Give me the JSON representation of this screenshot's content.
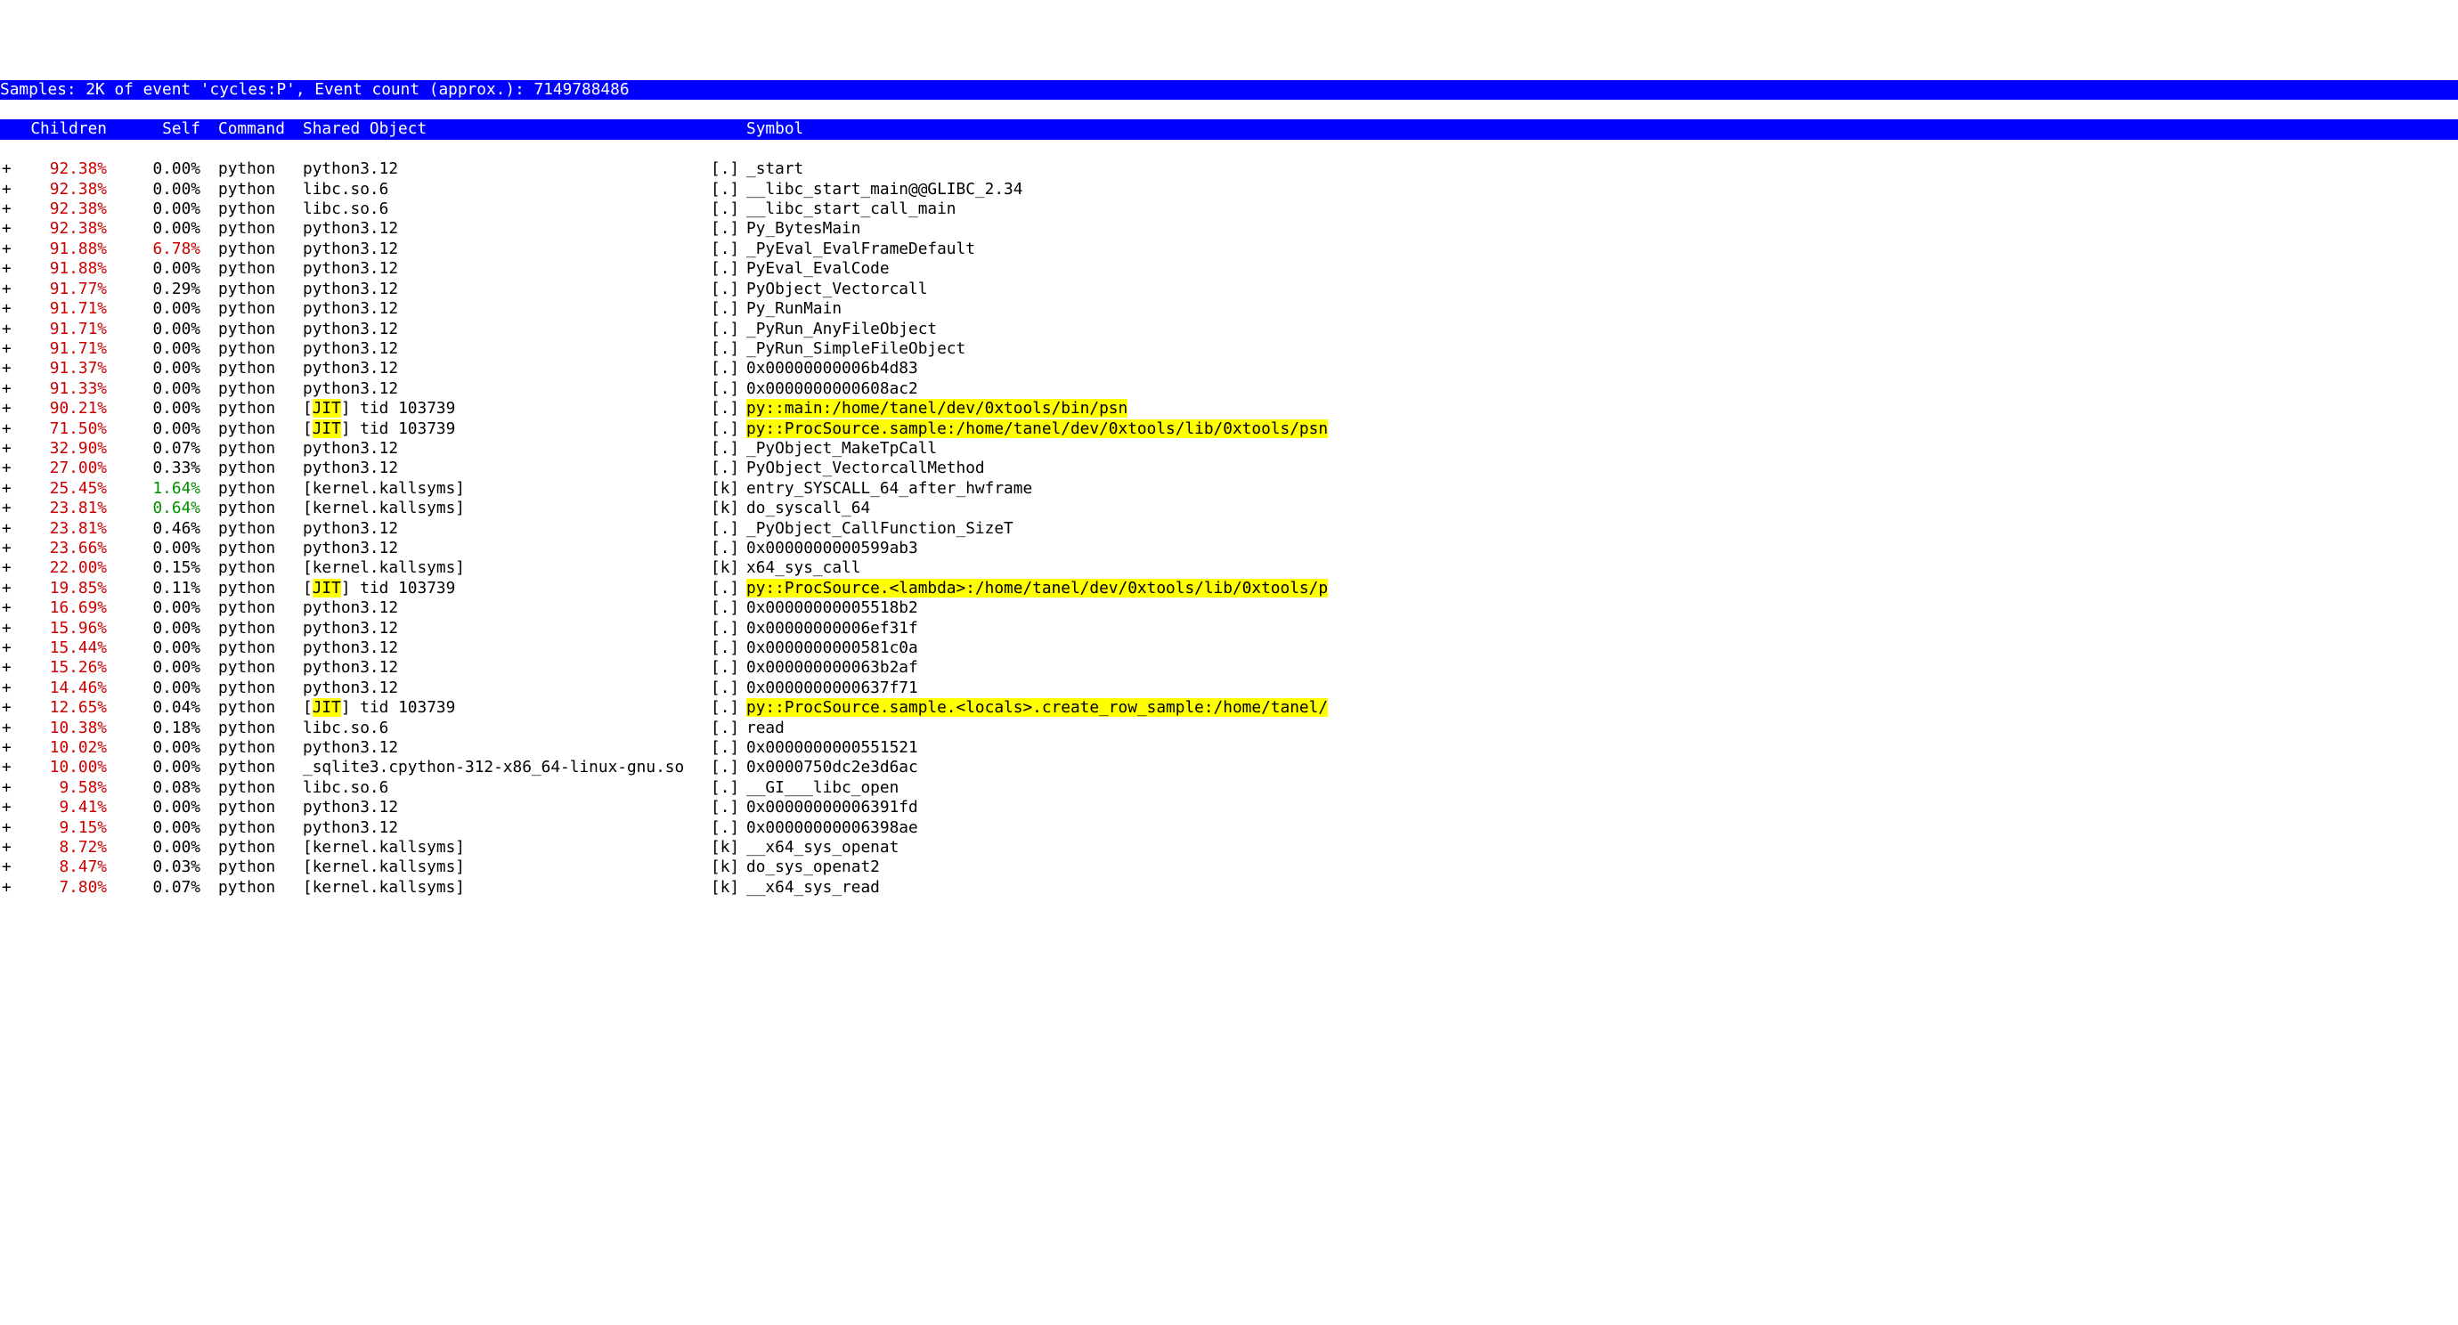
{
  "header1": "Samples: 2K of event 'cycles:P', Event count (approx.): 7149788486",
  "header2": {
    "children": "Children",
    "self": "Self",
    "command": "Command",
    "shared": "Shared Object",
    "symbol": "Symbol"
  },
  "rows": [
    {
      "expand": "+",
      "children": "92.38%",
      "self": "0.00%",
      "command": "python",
      "shared_plain": "python3.12",
      "shared_jit": false,
      "symtype": "[.]",
      "symbol": "_start",
      "hl": false
    },
    {
      "expand": "+",
      "children": "92.38%",
      "self": "0.00%",
      "command": "python",
      "shared_plain": "libc.so.6",
      "shared_jit": false,
      "symtype": "[.]",
      "symbol": "__libc_start_main@@GLIBC_2.34",
      "hl": false
    },
    {
      "expand": "+",
      "children": "92.38%",
      "self": "0.00%",
      "command": "python",
      "shared_plain": "libc.so.6",
      "shared_jit": false,
      "symtype": "[.]",
      "symbol": "__libc_start_call_main",
      "hl": false
    },
    {
      "expand": "+",
      "children": "92.38%",
      "self": "0.00%",
      "command": "python",
      "shared_plain": "python3.12",
      "shared_jit": false,
      "symtype": "[.]",
      "symbol": "Py_BytesMain",
      "hl": false
    },
    {
      "expand": "+",
      "children": "91.88%",
      "self": "6.78%",
      "self_red": true,
      "command": "python",
      "shared_plain": "python3.12",
      "shared_jit": false,
      "symtype": "[.]",
      "symbol": "_PyEval_EvalFrameDefault",
      "hl": false
    },
    {
      "expand": "+",
      "children": "91.88%",
      "self": "0.00%",
      "command": "python",
      "shared_plain": "python3.12",
      "shared_jit": false,
      "symtype": "[.]",
      "symbol": "PyEval_EvalCode",
      "hl": false
    },
    {
      "expand": "+",
      "children": "91.77%",
      "self": "0.29%",
      "command": "python",
      "shared_plain": "python3.12",
      "shared_jit": false,
      "symtype": "[.]",
      "symbol": "PyObject_Vectorcall",
      "hl": false
    },
    {
      "expand": "+",
      "children": "91.71%",
      "self": "0.00%",
      "command": "python",
      "shared_plain": "python3.12",
      "shared_jit": false,
      "symtype": "[.]",
      "symbol": "Py_RunMain",
      "hl": false
    },
    {
      "expand": "+",
      "children": "91.71%",
      "self": "0.00%",
      "command": "python",
      "shared_plain": "python3.12",
      "shared_jit": false,
      "symtype": "[.]",
      "symbol": "_PyRun_AnyFileObject",
      "hl": false
    },
    {
      "expand": "+",
      "children": "91.71%",
      "self": "0.00%",
      "command": "python",
      "shared_plain": "python3.12",
      "shared_jit": false,
      "symtype": "[.]",
      "symbol": "_PyRun_SimpleFileObject",
      "hl": false
    },
    {
      "expand": "+",
      "children": "91.37%",
      "self": "0.00%",
      "command": "python",
      "shared_plain": "python3.12",
      "shared_jit": false,
      "symtype": "[.]",
      "symbol": "0x00000000006b4d83",
      "hl": false
    },
    {
      "expand": "+",
      "children": "91.33%",
      "self": "0.00%",
      "command": "python",
      "shared_plain": "python3.12",
      "shared_jit": false,
      "symtype": "[.]",
      "symbol": "0x0000000000608ac2",
      "hl": false
    },
    {
      "expand": "+",
      "children": "90.21%",
      "self": "0.00%",
      "command": "python",
      "shared_jit": true,
      "shared_suffix": "] tid 103739",
      "symtype": "[.]",
      "symbol": "py::main:/home/tanel/dev/0xtools/bin/psn",
      "hl": true
    },
    {
      "expand": "+",
      "children": "71.50%",
      "self": "0.00%",
      "command": "python",
      "shared_jit": true,
      "shared_suffix": "] tid 103739",
      "symtype": "[.]",
      "symbol": "py::ProcSource.sample:/home/tanel/dev/0xtools/lib/0xtools/psn",
      "hl": true
    },
    {
      "expand": "+",
      "children": "32.90%",
      "self": "0.07%",
      "command": "python",
      "shared_plain": "python3.12",
      "shared_jit": false,
      "symtype": "[.]",
      "symbol": "_PyObject_MakeTpCall",
      "hl": false
    },
    {
      "expand": "+",
      "children": "27.00%",
      "self": "0.33%",
      "command": "python",
      "shared_plain": "python3.12",
      "shared_jit": false,
      "symtype": "[.]",
      "symbol": "PyObject_VectorcallMethod",
      "hl": false
    },
    {
      "expand": "+",
      "children": "25.45%",
      "self": "1.64%",
      "self_green": true,
      "command": "python",
      "shared_plain": "[kernel.kallsyms]",
      "shared_jit": false,
      "symtype": "[k]",
      "symbol": "entry_SYSCALL_64_after_hwframe",
      "hl": false
    },
    {
      "expand": "+",
      "children": "23.81%",
      "self": "0.64%",
      "self_green": true,
      "command": "python",
      "shared_plain": "[kernel.kallsyms]",
      "shared_jit": false,
      "symtype": "[k]",
      "symbol": "do_syscall_64",
      "hl": false
    },
    {
      "expand": "+",
      "children": "23.81%",
      "self": "0.46%",
      "command": "python",
      "shared_plain": "python3.12",
      "shared_jit": false,
      "symtype": "[.]",
      "symbol": "_PyObject_CallFunction_SizeT",
      "hl": false
    },
    {
      "expand": "+",
      "children": "23.66%",
      "self": "0.00%",
      "command": "python",
      "shared_plain": "python3.12",
      "shared_jit": false,
      "symtype": "[.]",
      "symbol": "0x0000000000599ab3",
      "hl": false
    },
    {
      "expand": "+",
      "children": "22.00%",
      "self": "0.15%",
      "command": "python",
      "shared_plain": "[kernel.kallsyms]",
      "shared_jit": false,
      "symtype": "[k]",
      "symbol": "x64_sys_call",
      "hl": false
    },
    {
      "expand": "+",
      "children": "19.85%",
      "self": "0.11%",
      "command": "python",
      "shared_jit": true,
      "shared_suffix": "] tid 103739",
      "symtype": "[.]",
      "symbol": "py::ProcSource.<lambda>:/home/tanel/dev/0xtools/lib/0xtools/p",
      "hl": true
    },
    {
      "expand": "+",
      "children": "16.69%",
      "self": "0.00%",
      "command": "python",
      "shared_plain": "python3.12",
      "shared_jit": false,
      "symtype": "[.]",
      "symbol": "0x00000000005518b2",
      "hl": false
    },
    {
      "expand": "+",
      "children": "15.96%",
      "self": "0.00%",
      "command": "python",
      "shared_plain": "python3.12",
      "shared_jit": false,
      "symtype": "[.]",
      "symbol": "0x00000000006ef31f",
      "hl": false
    },
    {
      "expand": "+",
      "children": "15.44%",
      "self": "0.00%",
      "command": "python",
      "shared_plain": "python3.12",
      "shared_jit": false,
      "symtype": "[.]",
      "symbol": "0x0000000000581c0a",
      "hl": false
    },
    {
      "expand": "+",
      "children": "15.26%",
      "self": "0.00%",
      "command": "python",
      "shared_plain": "python3.12",
      "shared_jit": false,
      "symtype": "[.]",
      "symbol": "0x000000000063b2af",
      "hl": false
    },
    {
      "expand": "+",
      "children": "14.46%",
      "self": "0.00%",
      "command": "python",
      "shared_plain": "python3.12",
      "shared_jit": false,
      "symtype": "[.]",
      "symbol": "0x0000000000637f71",
      "hl": false
    },
    {
      "expand": "+",
      "children": "12.65%",
      "self": "0.04%",
      "command": "python",
      "shared_jit": true,
      "shared_suffix": "] tid 103739",
      "symtype": "[.]",
      "symbol": "py::ProcSource.sample.<locals>.create_row_sample:/home/tanel/",
      "hl": true
    },
    {
      "expand": "+",
      "children": "10.38%",
      "self": "0.18%",
      "command": "python",
      "shared_plain": "libc.so.6",
      "shared_jit": false,
      "symtype": "[.]",
      "symbol": "read",
      "hl": false
    },
    {
      "expand": "+",
      "children": "10.02%",
      "self": "0.00%",
      "command": "python",
      "shared_plain": "python3.12",
      "shared_jit": false,
      "symtype": "[.]",
      "symbol": "0x0000000000551521",
      "hl": false
    },
    {
      "expand": "+",
      "children": "10.00%",
      "self": "0.00%",
      "command": "python",
      "shared_plain": "_sqlite3.cpython-312-x86_64-linux-gnu.so",
      "shared_jit": false,
      "symtype": "[.]",
      "symbol": "0x0000750dc2e3d6ac",
      "hl": false
    },
    {
      "expand": "+",
      "children": "9.58%",
      "self": "0.08%",
      "command": "python",
      "shared_plain": "libc.so.6",
      "shared_jit": false,
      "symtype": "[.]",
      "symbol": "__GI___libc_open",
      "hl": false
    },
    {
      "expand": "+",
      "children": "9.41%",
      "self": "0.00%",
      "command": "python",
      "shared_plain": "python3.12",
      "shared_jit": false,
      "symtype": "[.]",
      "symbol": "0x00000000006391fd",
      "hl": false
    },
    {
      "expand": "+",
      "children": "9.15%",
      "self": "0.00%",
      "command": "python",
      "shared_plain": "python3.12",
      "shared_jit": false,
      "symtype": "[.]",
      "symbol": "0x00000000006398ae",
      "hl": false
    },
    {
      "expand": "+",
      "children": "8.72%",
      "self": "0.00%",
      "command": "python",
      "shared_plain": "[kernel.kallsyms]",
      "shared_jit": false,
      "symtype": "[k]",
      "symbol": "__x64_sys_openat",
      "hl": false
    },
    {
      "expand": "+",
      "children": "8.47%",
      "self": "0.03%",
      "command": "python",
      "shared_plain": "[kernel.kallsyms]",
      "shared_jit": false,
      "symtype": "[k]",
      "symbol": "do_sys_openat2",
      "hl": false
    },
    {
      "expand": "+",
      "children": "7.80%",
      "self": "0.07%",
      "command": "python",
      "shared_plain": "[kernel.kallsyms]",
      "shared_jit": false,
      "symtype": "[k]",
      "symbol": "__x64_sys_read",
      "hl": false
    }
  ],
  "jit_label": "JIT"
}
